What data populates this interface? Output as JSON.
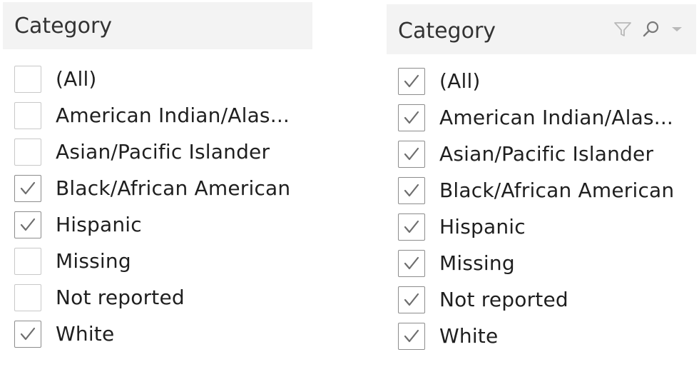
{
  "left_filter": {
    "title": "Category",
    "items": [
      {
        "label": "(All)",
        "checked": false
      },
      {
        "label": "American Indian/Alas...",
        "checked": false
      },
      {
        "label": "Asian/Pacific Islander",
        "checked": false
      },
      {
        "label": "Black/African American",
        "checked": true
      },
      {
        "label": "Hispanic",
        "checked": true
      },
      {
        "label": "Missing",
        "checked": false
      },
      {
        "label": "Not reported",
        "checked": false
      },
      {
        "label": "White",
        "checked": true
      }
    ]
  },
  "right_filter": {
    "title": "Category",
    "tools": [
      "filter-icon",
      "search-icon",
      "dropdown-arrow-icon"
    ],
    "items": [
      {
        "label": "(All)",
        "checked": true
      },
      {
        "label": "American Indian/Alas...",
        "checked": true
      },
      {
        "label": "Asian/Pacific Islander",
        "checked": true
      },
      {
        "label": "Black/African American",
        "checked": true
      },
      {
        "label": "Hispanic",
        "checked": true
      },
      {
        "label": "Missing",
        "checked": true
      },
      {
        "label": "Not reported",
        "checked": true
      },
      {
        "label": "White",
        "checked": true
      }
    ]
  },
  "colors": {
    "header_bg": "#f3f3f3",
    "checkbox_border": "#c8c8c8",
    "checkbox_checked_border": "#8c8c8c",
    "checkmark": "#6e6e6e",
    "tool_icons": "#b9b9b9"
  }
}
